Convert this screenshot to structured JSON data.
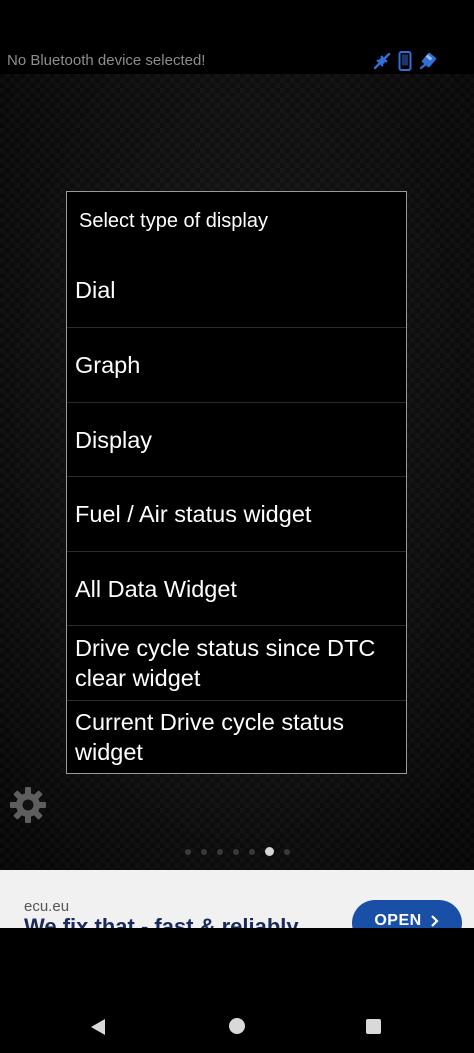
{
  "top_bar": {
    "bluetooth_status": "No Bluetooth device selected!",
    "icons": [
      "connection-icon",
      "phone-icon",
      "ecu-icon"
    ],
    "icon_color": "#2f6fd6"
  },
  "dialog": {
    "title": "Select type of display",
    "options": [
      "Dial",
      "Graph",
      "Display",
      "Fuel / Air status widget",
      "All Data Widget",
      "Drive cycle status since DTC clear widget",
      "Current Drive cycle status widget"
    ]
  },
  "settings": {
    "icon": "gear-icon"
  },
  "page_indicator": {
    "count": 7,
    "active_index": 5
  },
  "ad": {
    "domain": "ecu.eu",
    "headline": "We fix that - fast & reliably",
    "button_label": "OPEN",
    "accent_color": "#1a4fa8"
  },
  "nav_bar": {
    "icons": [
      "back-icon",
      "home-icon",
      "recents-icon"
    ]
  }
}
